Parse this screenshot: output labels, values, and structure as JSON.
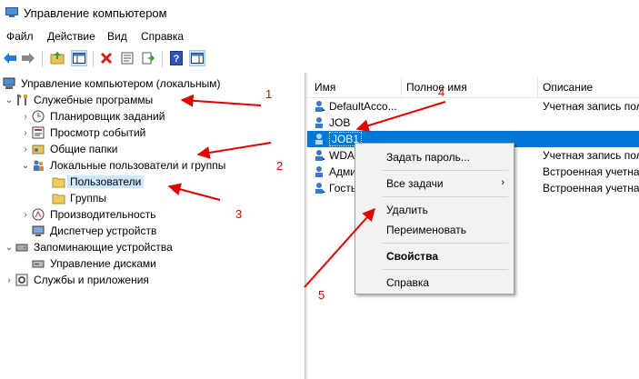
{
  "window": {
    "title": "Управление компьютером",
    "icon": "computer-management-icon"
  },
  "menu": [
    "Файл",
    "Действие",
    "Вид",
    "Справка"
  ],
  "toolbar": {
    "icons": [
      "back-arrow-icon",
      "forward-arrow-icon",
      "up-folder-icon",
      "show-hide-tree-icon",
      "delete-icon",
      "properties-icon",
      "export-list-icon",
      "help-icon",
      "action-pane-icon"
    ]
  },
  "tree": {
    "root": "Управление компьютером (локальным)",
    "items": [
      {
        "label": "Служебные программы",
        "icon": "tools-icon"
      },
      {
        "label": "Планировщик заданий",
        "icon": "clock-icon"
      },
      {
        "label": "Просмотр событий",
        "icon": "event-viewer-icon"
      },
      {
        "label": "Общие папки",
        "icon": "shared-folder-icon"
      },
      {
        "label": "Локальные пользователи и группы",
        "icon": "users-icon"
      },
      {
        "label": "Пользователи",
        "icon": "folder-icon",
        "selected": true
      },
      {
        "label": "Группы",
        "icon": "folder-icon"
      },
      {
        "label": "Производительность",
        "icon": "performance-icon"
      },
      {
        "label": "Диспетчер устройств",
        "icon": "device-manager-icon"
      },
      {
        "label": "Запоминающие устройства",
        "icon": "storage-icon"
      },
      {
        "label": "Управление дисками",
        "icon": "disk-icon"
      },
      {
        "label": "Службы и приложения",
        "icon": "services-icon"
      }
    ]
  },
  "list": {
    "columns": [
      "Имя",
      "Полное имя",
      "Описание"
    ],
    "rows": [
      {
        "name": "DefaultAcco...",
        "desc": "Учетная запись пол"
      },
      {
        "name": "JOB",
        "desc": ""
      },
      {
        "name": "JOB1",
        "desc": "",
        "selected": true
      },
      {
        "name": "WDA",
        "desc": "Учетная запись пол"
      },
      {
        "name": "Адми",
        "desc": "Встроенная учетная"
      },
      {
        "name": "Гость",
        "desc": "Встроенная учетная"
      }
    ]
  },
  "context_menu": {
    "set_password": "Задать пароль...",
    "all_tasks": "Все задачи",
    "delete": "Удалить",
    "rename": "Переименовать",
    "properties": "Свойства",
    "help": "Справка"
  },
  "annotations": {
    "n1": "1",
    "n2": "2",
    "n3": "3",
    "n4": "4",
    "n5": "5",
    "color": "#e00000"
  }
}
